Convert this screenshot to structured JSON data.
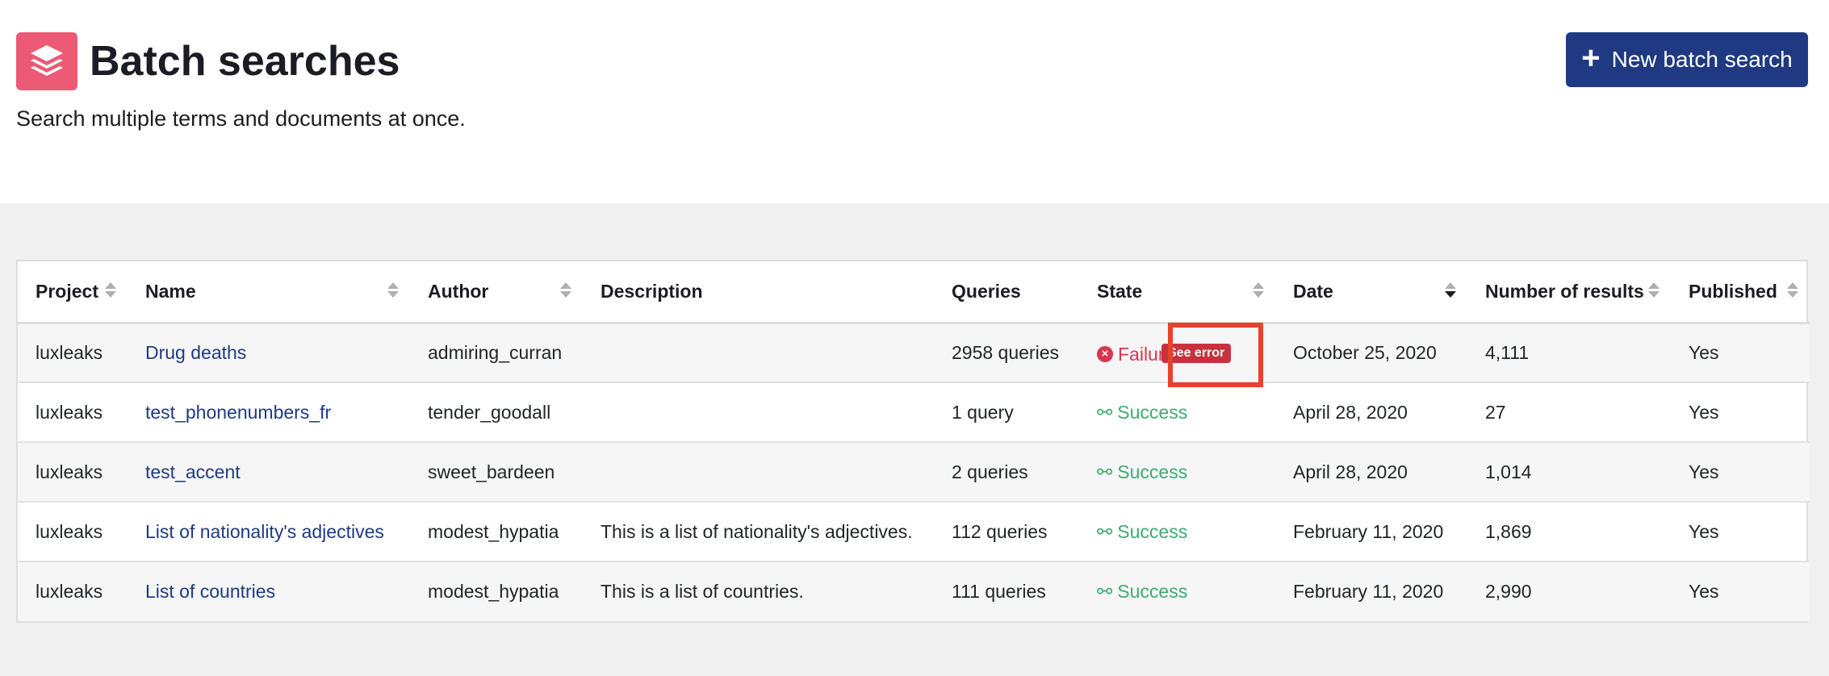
{
  "header": {
    "title": "Batch searches",
    "subtitle": "Search multiple terms and documents at once.",
    "new_button_label": "New batch search",
    "logo_icon": "layers-icon",
    "brand_color": "#ec5a76",
    "button_color": "#1f3a82"
  },
  "table": {
    "columns": [
      "Project",
      "Name",
      "Author",
      "Description",
      "Queries",
      "State",
      "Date",
      "Number of results",
      "Published"
    ],
    "sorted_column": "Date",
    "see_error_label": "See error",
    "rows": [
      {
        "project": "luxleaks",
        "name": "Drug deaths",
        "author": "admiring_curran",
        "description": "",
        "queries": "2958 queries",
        "state": "Failure",
        "date": "October 25, 2020",
        "results": "4,111",
        "published": "Yes"
      },
      {
        "project": "luxleaks",
        "name": "test_phonenumbers_fr",
        "author": "tender_goodall",
        "description": "",
        "queries": "1 query",
        "state": "Success",
        "date": "April 28, 2020",
        "results": "27",
        "published": "Yes"
      },
      {
        "project": "luxleaks",
        "name": "test_accent",
        "author": "sweet_bardeen",
        "description": "",
        "queries": "2 queries",
        "state": "Success",
        "date": "April 28, 2020",
        "results": "1,014",
        "published": "Yes"
      },
      {
        "project": "luxleaks",
        "name": "List of nationality's adjectives",
        "author": "modest_hypatia",
        "description": "This is a list of nationality's adjectives.",
        "queries": "112 queries",
        "state": "Success",
        "date": "February 11, 2020",
        "results": "1,869",
        "published": "Yes"
      },
      {
        "project": "luxleaks",
        "name": "List of countries",
        "author": "modest_hypatia",
        "description": "This is a list of countries.",
        "queries": "111 queries",
        "state": "Success",
        "date": "February 11, 2020",
        "results": "2,990",
        "published": "Yes"
      }
    ]
  },
  "colors": {
    "failure": "#d9364f",
    "success": "#3eab73",
    "highlight": "#e8412c"
  }
}
